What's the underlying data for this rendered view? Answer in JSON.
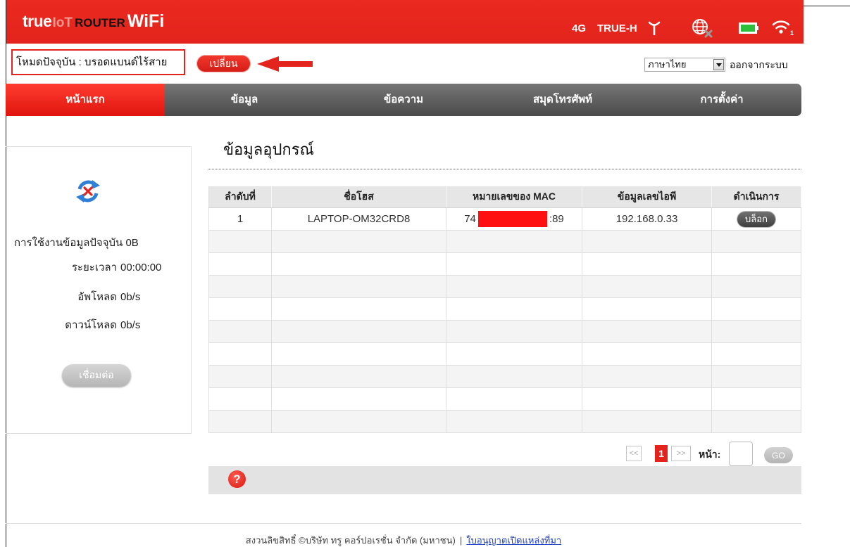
{
  "header": {
    "logo": {
      "brand": "true",
      "iot": "IoT",
      "router": "ROUTER",
      "wifi": "WiFi"
    },
    "network_type": "4G",
    "operator": "TRUE-H",
    "wifi_clients": "1",
    "icons": {
      "signal": "signal-antenna-icon",
      "internet": "globe-disconnected-icon",
      "battery": "battery-icon",
      "wifi": "wifi-icon"
    }
  },
  "mode_bar": {
    "current_mode": "โหมดปัจจุบัน : บรอดแบนด์ไร้สาย",
    "change_button": "เปลี่ยน",
    "language": "ภาษาไทย",
    "logout": "ออกจากระบบ"
  },
  "nav": {
    "items": [
      {
        "label": "หน้าแรก",
        "active": true
      },
      {
        "label": "ข้อมูล",
        "active": false
      },
      {
        "label": "ข้อความ",
        "active": false
      },
      {
        "label": "สมุดโทรศัพท์",
        "active": false
      },
      {
        "label": "การตั้งค่า",
        "active": false
      }
    ]
  },
  "status_panel": {
    "icon": "refresh-disconnected-icon",
    "usage_label": "การใช้งานข้อมูลปัจจุบัน",
    "usage_value": "0B",
    "duration_label": "ระยะเวลา",
    "duration_value": "00:00:00",
    "upload_label": "อัพโหลด",
    "upload_value": "0b/s",
    "download_label": "ดาวน์โหลด",
    "download_value": "0b/s",
    "connect_button": "เชื่อมต่อ"
  },
  "devices": {
    "title": "ข้อมูลอุปกรณ์",
    "columns": [
      "ลำดับที่",
      "ชื่อโฮส",
      "หมายเลขของ MAC",
      "ข้อมูลเลขไอพี",
      "ดำเนินการ"
    ],
    "rows": [
      {
        "index": "1",
        "host": "LAPTOP-OM32CRD8",
        "mac_start": "74",
        "mac_end": ":89",
        "ip": "192.168.0.33",
        "action": "บล็อก"
      }
    ]
  },
  "pagination": {
    "first": "<<",
    "current": "1",
    "last": ">>",
    "page_label": "หน้า:",
    "page_input": "",
    "go": "GO"
  },
  "help": {
    "icon": "?"
  },
  "footer": {
    "copyright": "สงวนลิขสิทธิ์ ©บริษัท ทรู คอร์ปอเรชั่น จำกัด (มหาชน)",
    "separator": "|",
    "license_link": "ใบอนุญาตเปิดแหล่งที่มา"
  },
  "colors": {
    "brand_red": "#e3241c",
    "nav_gray": "#4a4a4a",
    "redaction": "#ff1010",
    "link_blue": "#1f3fbf",
    "battery_green": "#2dbe3c",
    "refresh_blue": "#2f7fd6"
  }
}
